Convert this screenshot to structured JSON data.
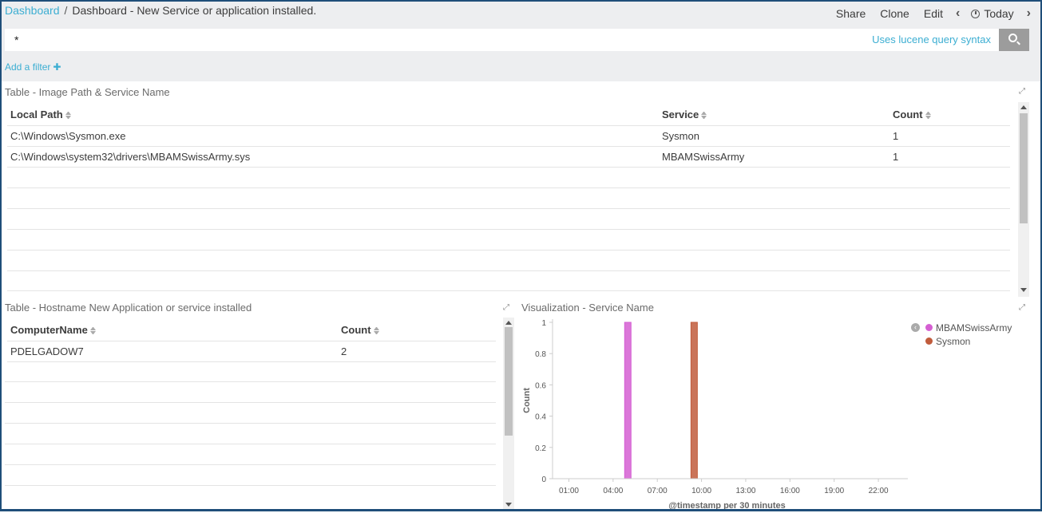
{
  "breadcrumb": {
    "root": "Dashboard",
    "separator": "/",
    "current": "Dashboard - New Service or application installed."
  },
  "toolbar": {
    "share": "Share",
    "clone": "Clone",
    "edit": "Edit",
    "prev": "‹",
    "time": "Today",
    "next": "›"
  },
  "query": {
    "value": "*",
    "hint": "Uses lucene query syntax"
  },
  "filter": {
    "add_label": "Add a filter",
    "plus": "✚"
  },
  "panel1": {
    "title": "Table - Image Path & Service Name",
    "columns": [
      "Local Path",
      "Service",
      "Count"
    ],
    "rows": [
      [
        "C:\\Windows\\Sysmon.exe",
        "Sysmon",
        "1"
      ],
      [
        "C:\\Windows\\system32\\drivers\\MBAMSwissArmy.sys",
        "MBAMSwissArmy",
        "1"
      ]
    ]
  },
  "panel2": {
    "title": "Table - Hostname New Application or service installed",
    "columns": [
      "ComputerName",
      "Count"
    ],
    "rows": [
      [
        "PDELGADOW7",
        "2"
      ]
    ]
  },
  "panel3": {
    "title": "Visualization - Service Name"
  },
  "colors": {
    "accent": "#3caed2",
    "mbam": "#d55fd2",
    "sysmon": "#c15c3c"
  },
  "chart_data": {
    "type": "bar",
    "title": "",
    "xlabel": "@timestamp per 30 minutes",
    "ylabel": "Count",
    "ylim": [
      0,
      1
    ],
    "yticks": [
      "0",
      "0.2",
      "0.4",
      "0.6",
      "0.8",
      "1"
    ],
    "xticks": [
      "01:00",
      "04:00",
      "07:00",
      "10:00",
      "13:00",
      "16:00",
      "19:00",
      "22:00"
    ],
    "legend_position": "top-right",
    "grid": false,
    "series": [
      {
        "name": "MBAMSwissArmy",
        "x": "05:00",
        "values": [
          1
        ]
      },
      {
        "name": "Sysmon",
        "x": "09:30",
        "values": [
          1
        ]
      }
    ]
  }
}
